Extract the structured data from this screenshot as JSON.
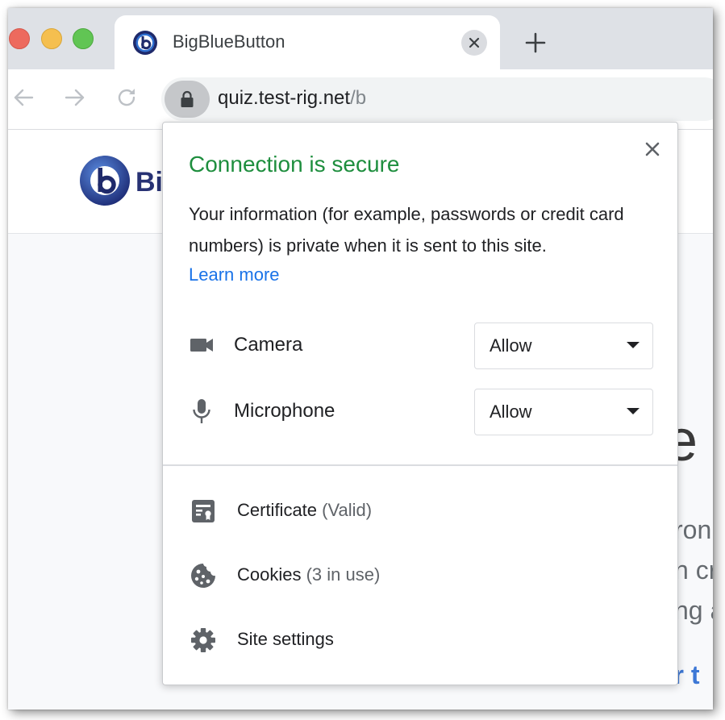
{
  "browser": {
    "tab": {
      "title": "BigBlueButton"
    },
    "address": {
      "host": "quiz.test-rig.net",
      "path": "/b"
    }
  },
  "page": {
    "logo_text": "Big",
    "fragments": {
      "heading": "e t",
      "line1": "ron",
      "line2": "n cr",
      "line3": "ng a",
      "link": "ur t"
    }
  },
  "site_info": {
    "title": "Connection is secure",
    "description": "Your information (for example, passwords or credit card numbers) is private when it is sent to this site.",
    "learn_more": "Learn more",
    "permissions": [
      {
        "icon": "camera-icon",
        "label": "Camera",
        "value": "Allow"
      },
      {
        "icon": "microphone-icon",
        "label": "Microphone",
        "value": "Allow"
      }
    ],
    "menu": [
      {
        "icon": "certificate-icon",
        "label": "Certificate",
        "detail": "(Valid)"
      },
      {
        "icon": "cookie-icon",
        "label": "Cookies",
        "detail": "(3 in use)"
      },
      {
        "icon": "gear-icon",
        "label": "Site settings",
        "detail": ""
      }
    ]
  },
  "colors": {
    "secure_green": "#1e8e3e",
    "link_blue": "#1a73e8",
    "brand_navy": "#283274"
  }
}
